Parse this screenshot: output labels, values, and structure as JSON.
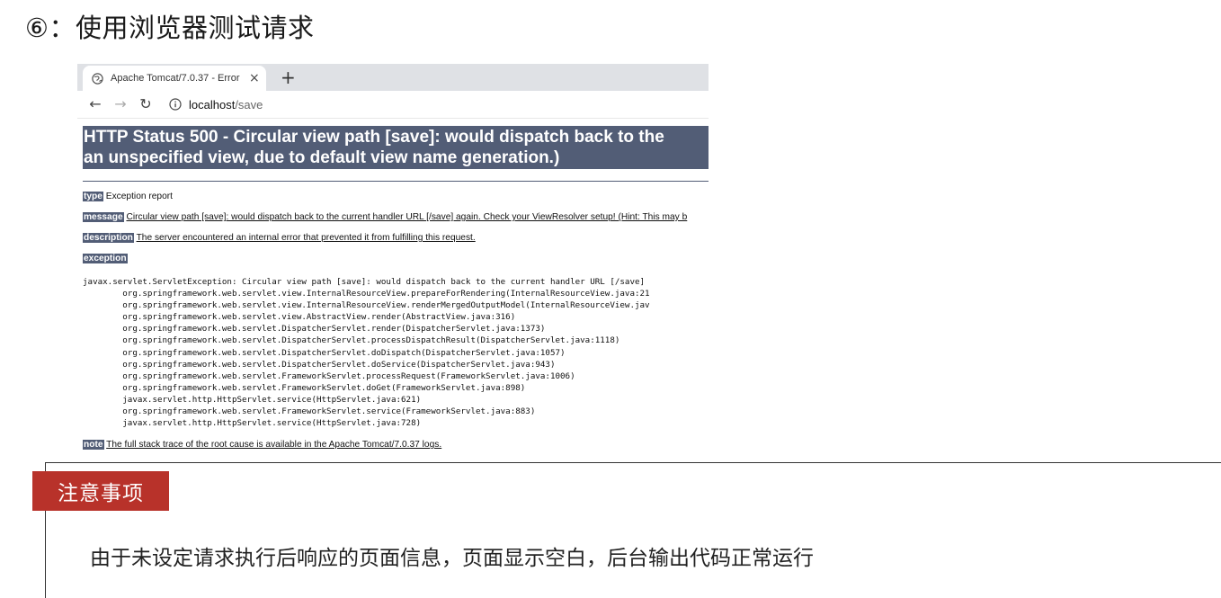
{
  "slide": {
    "title": "⑥：使用浏览器测试请求",
    "notice_badge": "注意事项",
    "notice_text": "由于未设定请求执行后响应的页面信息，页面显示空白，后台输出代码正常运行"
  },
  "browser": {
    "tab_title": "Apache Tomcat/7.0.37 - Error",
    "tab_close": "×",
    "new_tab": "+",
    "back": "←",
    "forward": "→",
    "reload": "↻",
    "url_host": "localhost",
    "url_path": "/save"
  },
  "error_page": {
    "heading_line1": "HTTP Status 500 - Circular view path [save]: would dispatch back to the",
    "heading_line2": "an unspecified view, due to default view name generation.)",
    "type_label": "type",
    "type_value": " Exception report",
    "message_label": "message",
    "message_value": "Circular view path [save]: would dispatch back to the current handler URL [/save] again. Check your ViewResolver setup! (Hint: This may b",
    "description_label": "description",
    "description_value": "The server encountered an internal error that prevented it from fulfilling this request.",
    "exception_label": "exception",
    "stack_trace": "javax.servlet.ServletException: Circular view path [save]: would dispatch back to the current handler URL [/save]\n\torg.springframework.web.servlet.view.InternalResourceView.prepareForRendering(InternalResourceView.java:21\n\torg.springframework.web.servlet.view.InternalResourceView.renderMergedOutputModel(InternalResourceView.jav\n\torg.springframework.web.servlet.view.AbstractView.render(AbstractView.java:316)\n\torg.springframework.web.servlet.DispatcherServlet.render(DispatcherServlet.java:1373)\n\torg.springframework.web.servlet.DispatcherServlet.processDispatchResult(DispatcherServlet.java:1118)\n\torg.springframework.web.servlet.DispatcherServlet.doDispatch(DispatcherServlet.java:1057)\n\torg.springframework.web.servlet.DispatcherServlet.doService(DispatcherServlet.java:943)\n\torg.springframework.web.servlet.FrameworkServlet.processRequest(FrameworkServlet.java:1006)\n\torg.springframework.web.servlet.FrameworkServlet.doGet(FrameworkServlet.java:898)\n\tjavax.servlet.http.HttpServlet.service(HttpServlet.java:621)\n\torg.springframework.web.servlet.FrameworkServlet.service(FrameworkServlet.java:883)\n\tjavax.servlet.http.HttpServlet.service(HttpServlet.java:728)",
    "note_label": "note",
    "note_value": "The full stack trace of the root cause is available in the Apache Tomcat/7.0.37 logs."
  },
  "colors": {
    "tomcat_header": "#525d76",
    "badge": "#b8322a",
    "tab_strip": "#dfe1e5"
  }
}
